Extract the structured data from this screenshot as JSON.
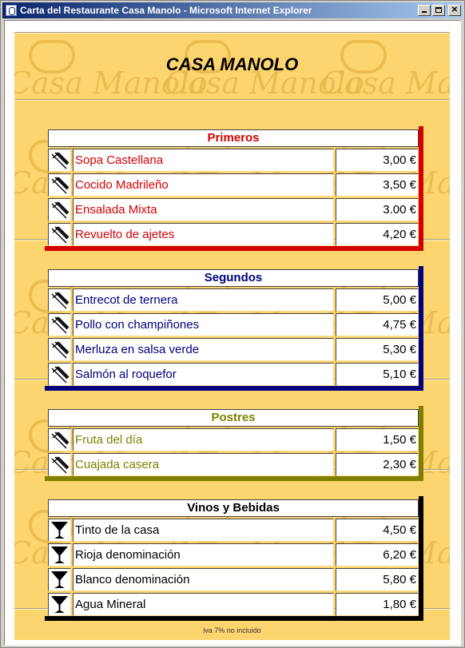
{
  "window": {
    "title": "Carta del Restaurante Casa Manolo - Microsoft Internet Explorer"
  },
  "header": {
    "title": "CASA MANOLO",
    "watermark": "Casa Manolo"
  },
  "colors": {
    "primeros": "#d40000",
    "segundos": "#000080",
    "postres": "#808000",
    "vinos": "#000000",
    "background": "#fdd56f"
  },
  "sections": {
    "primeros": {
      "title": "Primeros",
      "items": [
        {
          "icon": "cutlery-icon",
          "name": "Sopa Castellana",
          "price": "3,00 €"
        },
        {
          "icon": "cutlery-icon",
          "name": "Cocido Madrileño",
          "price": "3,50 €"
        },
        {
          "icon": "cutlery-icon",
          "name": "Ensalada Mixta",
          "price": "3.00 €"
        },
        {
          "icon": "cutlery-icon",
          "name": "Revuelto de ajetes",
          "price": "4,20 €"
        }
      ]
    },
    "segundos": {
      "title": "Segundos",
      "items": [
        {
          "icon": "cutlery-icon",
          "name": "Entrecot de ternera",
          "price": "5,00 €"
        },
        {
          "icon": "cutlery-icon",
          "name": "Pollo con champiñones",
          "price": "4,75 €"
        },
        {
          "icon": "cutlery-icon",
          "name": "Merluza en salsa verde",
          "price": "5,30 €"
        },
        {
          "icon": "cutlery-icon",
          "name": "Salmón al roquefor",
          "price": "5,10 €"
        }
      ]
    },
    "postres": {
      "title": "Postres",
      "items": [
        {
          "icon": "cutlery-icon",
          "name": "Fruta del día",
          "price": "1,50 €"
        },
        {
          "icon": "cutlery-icon",
          "name": "Cuajada casera",
          "price": "2,30 €"
        }
      ]
    },
    "vinos": {
      "title": "Vinos y Bebidas",
      "items": [
        {
          "icon": "wine-glass-icon",
          "name": "Tinto de la casa",
          "price": "4,50 €"
        },
        {
          "icon": "wine-glass-icon",
          "name": "Rioja denominación",
          "price": "6,20 €"
        },
        {
          "icon": "wine-glass-icon",
          "name": "Blanco denominación",
          "price": "5,80 €"
        },
        {
          "icon": "wine-glass-icon",
          "name": "Agua Mineral",
          "price": "1,80 €"
        }
      ]
    }
  },
  "footer": {
    "note": "iva 7% no incluido"
  }
}
